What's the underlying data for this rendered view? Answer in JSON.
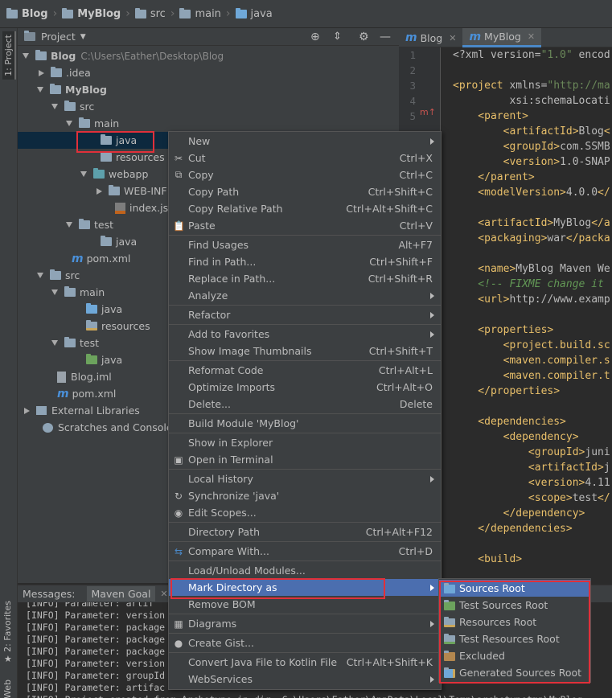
{
  "breadcrumb": [
    "Blog",
    "MyBlog",
    "src",
    "main",
    "java"
  ],
  "left_strip": {
    "project_tab": "1: Project",
    "favorites_tab": "2: Favorites",
    "web_tab": "Web"
  },
  "project_panel": {
    "title": "Project"
  },
  "tree": [
    {
      "label": "Blog",
      "path": "C:\\Users\\Eather\\Desktop\\Blog",
      "bold": true,
      "arrow": "down",
      "icon": "folder",
      "indent": 0
    },
    {
      "label": ".idea",
      "arrow": "right",
      "icon": "folder",
      "indent": 1
    },
    {
      "label": "MyBlog",
      "bold": true,
      "arrow": "down",
      "icon": "folder",
      "indent": 1
    },
    {
      "label": "src",
      "arrow": "down",
      "icon": "folder",
      "indent": 2
    },
    {
      "label": "main",
      "arrow": "down",
      "icon": "folder",
      "indent": 3
    },
    {
      "label": "java",
      "arrow": "none",
      "icon": "folder",
      "indent": 4,
      "selected": true
    },
    {
      "label": "resources",
      "arrow": "none",
      "icon": "folder",
      "indent": 4
    },
    {
      "label": "webapp",
      "arrow": "down",
      "icon": "folder-cyan",
      "indent": 4
    },
    {
      "label": "WEB-INF",
      "arrow": "right",
      "icon": "folder",
      "indent": 5
    },
    {
      "label": "index.jsp",
      "arrow": "none",
      "icon": "jsp",
      "indent": 5
    },
    {
      "label": "test",
      "arrow": "down",
      "icon": "folder",
      "indent": 3
    },
    {
      "label": "java",
      "arrow": "none",
      "icon": "folder",
      "indent": 4
    },
    {
      "label": "pom.xml",
      "arrow": "none",
      "icon": "maven",
      "indent": 2
    },
    {
      "label": "src",
      "arrow": "down",
      "icon": "folder",
      "indent": 1
    },
    {
      "label": "main",
      "arrow": "down",
      "icon": "folder",
      "indent": 2
    },
    {
      "label": "java",
      "arrow": "none",
      "icon": "folder-blue",
      "indent": 3
    },
    {
      "label": "resources",
      "arrow": "none",
      "icon": "folder-res",
      "indent": 3
    },
    {
      "label": "test",
      "arrow": "down",
      "icon": "folder",
      "indent": 2
    },
    {
      "label": "java",
      "arrow": "none",
      "icon": "folder-green",
      "indent": 3
    },
    {
      "label": "Blog.iml",
      "arrow": "none",
      "icon": "iml",
      "indent": 1
    },
    {
      "label": "pom.xml",
      "arrow": "none",
      "icon": "maven",
      "indent": 1
    },
    {
      "label": "External Libraries",
      "arrow": "right",
      "icon": "lib",
      "indent": 0
    },
    {
      "label": "Scratches and Consoles",
      "arrow": "none",
      "icon": "scratch",
      "indent": 0
    }
  ],
  "editor": {
    "tabs": [
      {
        "label": "Blog",
        "active": false
      },
      {
        "label": "MyBlog",
        "active": true
      }
    ],
    "line_numbers": [
      "1",
      "2",
      "3",
      "4",
      "5"
    ],
    "code_lines": [
      [
        {
          "t": "<?xml version=",
          "c": "an"
        },
        {
          "t": "\"1.0\"",
          "c": "av"
        },
        {
          "t": " encod",
          "c": "an"
        }
      ],
      [],
      [
        {
          "t": "<project ",
          "c": "tg"
        },
        {
          "t": "xmlns=",
          "c": "an"
        },
        {
          "t": "\"http://ma",
          "c": "av"
        }
      ],
      [
        {
          "t": "         xsi:schemaLocati",
          "c": "an"
        }
      ],
      [
        {
          "t": "    <parent>",
          "c": "tg"
        }
      ],
      [
        {
          "t": "        <artifactId>",
          "c": "tg"
        },
        {
          "t": "Blog",
          "c": "an"
        },
        {
          "t": "<",
          "c": "tg"
        }
      ],
      [
        {
          "t": "        <groupId>",
          "c": "tg"
        },
        {
          "t": "com.SSMB",
          "c": "an"
        }
      ],
      [
        {
          "t": "        <version>",
          "c": "tg"
        },
        {
          "t": "1.0-SNAP",
          "c": "an"
        }
      ],
      [
        {
          "t": "    </parent>",
          "c": "tg"
        }
      ],
      [
        {
          "t": "    <modelVersion>",
          "c": "tg"
        },
        {
          "t": "4.0.0",
          "c": "an"
        },
        {
          "t": "</",
          "c": "tg"
        }
      ],
      [],
      [
        {
          "t": "    <artifactId>",
          "c": "tg"
        },
        {
          "t": "MyBlog",
          "c": "an"
        },
        {
          "t": "</a",
          "c": "tg"
        }
      ],
      [
        {
          "t": "    <packaging>",
          "c": "tg"
        },
        {
          "t": "war",
          "c": "an"
        },
        {
          "t": "</packa",
          "c": "tg"
        }
      ],
      [],
      [
        {
          "t": "    <name>",
          "c": "tg"
        },
        {
          "t": "MyBlog Maven We",
          "c": "an"
        }
      ],
      [
        {
          "t": "    <!-- FIXME change it",
          "c": "cm"
        }
      ],
      [
        {
          "t": "    <url>",
          "c": "tg"
        },
        {
          "t": "http://www.examp",
          "c": "an"
        }
      ],
      [],
      [
        {
          "t": "    <properties>",
          "c": "tg"
        }
      ],
      [
        {
          "t": "        <project.build.sc",
          "c": "tg"
        }
      ],
      [
        {
          "t": "        <maven.compiler.s",
          "c": "tg"
        }
      ],
      [
        {
          "t": "        <maven.compiler.t",
          "c": "tg"
        }
      ],
      [
        {
          "t": "    </properties>",
          "c": "tg"
        }
      ],
      [],
      [
        {
          "t": "    <dependencies>",
          "c": "tg"
        }
      ],
      [
        {
          "t": "        <dependency>",
          "c": "tg"
        }
      ],
      [
        {
          "t": "            <groupId>",
          "c": "tg"
        },
        {
          "t": "juni",
          "c": "an"
        }
      ],
      [
        {
          "t": "            <artifactId>",
          "c": "tg"
        },
        {
          "t": "j",
          "c": "an"
        }
      ],
      [
        {
          "t": "            <version>",
          "c": "tg"
        },
        {
          "t": "4.11",
          "c": "an"
        }
      ],
      [
        {
          "t": "            <scope>",
          "c": "tg"
        },
        {
          "t": "test",
          "c": "an"
        },
        {
          "t": "</",
          "c": "tg"
        }
      ],
      [
        {
          "t": "        </dependency>",
          "c": "tg"
        }
      ],
      [
        {
          "t": "    </dependencies>",
          "c": "tg"
        }
      ],
      [],
      [
        {
          "t": "    <build>",
          "c": "tg"
        }
      ]
    ]
  },
  "messages": {
    "tabs": [
      "Messages:",
      "Maven Goal"
    ],
    "lines": [
      "[INFO] Parameter: artif",
      "[INFO] Parameter: version",
      "[INFO] Parameter: package",
      "[INFO] Parameter: package",
      "[INFO] Parameter: package",
      "[INFO] Parameter: version",
      "[INFO] Parameter: groupId",
      "[INFO] Parameter: artifac",
      "[INFO] Project created from Archetype in dir: C:\\Users\\Eather\\AppData\\Local\\Temp\\archetypetmp\\MyBlog"
    ]
  },
  "context_menu": [
    {
      "label": "New",
      "submenu": true
    },
    {
      "label": "Cut",
      "shortcut": "Ctrl+X",
      "icon": "scissors-icon"
    },
    {
      "label": "Copy",
      "shortcut": "Ctrl+C",
      "icon": "copy-icon"
    },
    {
      "label": "Copy Path",
      "shortcut": "Ctrl+Shift+C"
    },
    {
      "label": "Copy Relative Path",
      "shortcut": "Ctrl+Alt+Shift+C"
    },
    {
      "label": "Paste",
      "shortcut": "Ctrl+V",
      "icon": "paste-icon"
    },
    {
      "sep": true
    },
    {
      "label": "Find Usages",
      "shortcut": "Alt+F7"
    },
    {
      "label": "Find in Path...",
      "shortcut": "Ctrl+Shift+F"
    },
    {
      "label": "Replace in Path...",
      "shortcut": "Ctrl+Shift+R"
    },
    {
      "label": "Analyze",
      "submenu": true
    },
    {
      "sep": true
    },
    {
      "label": "Refactor",
      "submenu": true
    },
    {
      "sep": true
    },
    {
      "label": "Add to Favorites",
      "submenu": true
    },
    {
      "label": "Show Image Thumbnails",
      "shortcut": "Ctrl+Shift+T"
    },
    {
      "sep": true
    },
    {
      "label": "Reformat Code",
      "shortcut": "Ctrl+Alt+L"
    },
    {
      "label": "Optimize Imports",
      "shortcut": "Ctrl+Alt+O"
    },
    {
      "label": "Delete...",
      "shortcut": "Delete"
    },
    {
      "sep": true
    },
    {
      "label": "Build Module 'MyBlog'"
    },
    {
      "sep": true
    },
    {
      "label": "Show in Explorer"
    },
    {
      "label": "Open in Terminal",
      "icon": "terminal-icon"
    },
    {
      "sep": true
    },
    {
      "label": "Local History",
      "submenu": true
    },
    {
      "label": "Synchronize 'java'",
      "icon": "sync-icon"
    },
    {
      "label": "Edit Scopes...",
      "icon": "scope-icon"
    },
    {
      "sep": true
    },
    {
      "label": "Directory Path",
      "shortcut": "Ctrl+Alt+F12"
    },
    {
      "sep": true
    },
    {
      "label": "Compare With...",
      "shortcut": "Ctrl+D",
      "icon": "compare-icon"
    },
    {
      "sep": true
    },
    {
      "label": "Load/Unload Modules..."
    },
    {
      "label": "Mark Directory as",
      "submenu": true,
      "highlighted": true
    },
    {
      "label": "Remove BOM"
    },
    {
      "sep": true
    },
    {
      "label": "Diagrams",
      "submenu": true,
      "icon": "diagram-icon"
    },
    {
      "sep": true
    },
    {
      "label": "Create Gist...",
      "icon": "github-icon"
    },
    {
      "sep": true
    },
    {
      "label": "Convert Java File to Kotlin File",
      "shortcut": "Ctrl+Alt+Shift+K"
    },
    {
      "label": "WebServices",
      "submenu": true
    }
  ],
  "submenu": [
    {
      "label": "Sources Root",
      "icon": "blue",
      "highlighted": true
    },
    {
      "label": "Test Sources Root",
      "icon": "green"
    },
    {
      "label": "Resources Root",
      "icon": "res"
    },
    {
      "label": "Test Resources Root",
      "icon": "testres"
    },
    {
      "label": "Excluded",
      "icon": "orange"
    },
    {
      "label": "Generated Sources Root",
      "icon": "gen"
    }
  ],
  "colors": {
    "accent": "#4b6eaf",
    "highlight_box": "#e0303a",
    "selection": "#0d293e"
  }
}
